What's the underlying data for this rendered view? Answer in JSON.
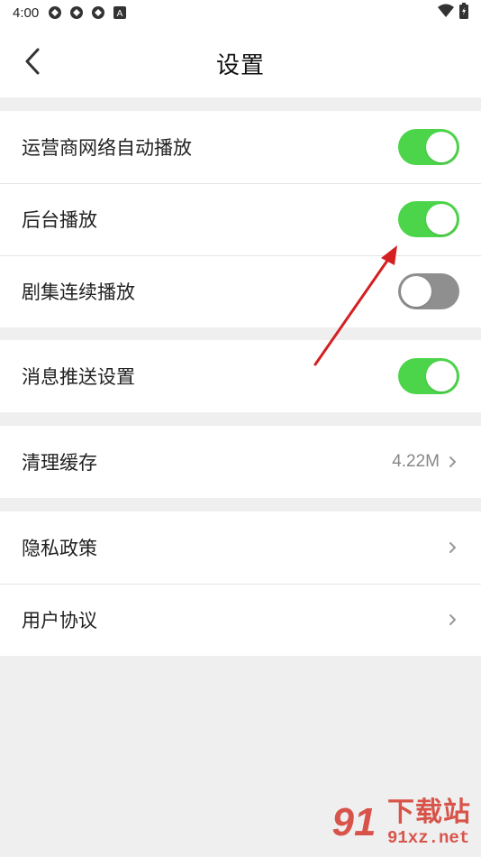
{
  "status_bar": {
    "time": "4:00",
    "left_icons": [
      "app-notification-icon",
      "app-notification-icon",
      "app-notification-icon",
      "a-notification-icon"
    ],
    "a_badge": "A",
    "right_icons": [
      "wifi-icon",
      "battery-icon"
    ]
  },
  "header": {
    "title": "设置",
    "back_icon": "chevron-left-icon"
  },
  "groups": [
    {
      "items": [
        {
          "label": "运营商网络自动播放",
          "type": "toggle",
          "on": true
        },
        {
          "label": "后台播放",
          "type": "toggle",
          "on": true
        },
        {
          "label": "剧集连续播放",
          "type": "toggle",
          "on": false
        }
      ]
    },
    {
      "items": [
        {
          "label": "消息推送设置",
          "type": "toggle",
          "on": true
        }
      ]
    },
    {
      "items": [
        {
          "label": "清理缓存",
          "type": "value",
          "value": "4.22M"
        }
      ]
    },
    {
      "items": [
        {
          "label": "隐私政策",
          "type": "link"
        },
        {
          "label": "用户协议",
          "type": "link"
        }
      ]
    }
  ],
  "colors": {
    "toggle_on": "#4cd54a",
    "toggle_off": "#8f8f8f",
    "page_background": "#efefef",
    "annotation_arrow": "#d42020",
    "watermark": "#d43a2e"
  },
  "watermark": {
    "logo": "91",
    "cn": "下载站",
    "en": "91xz.net"
  }
}
